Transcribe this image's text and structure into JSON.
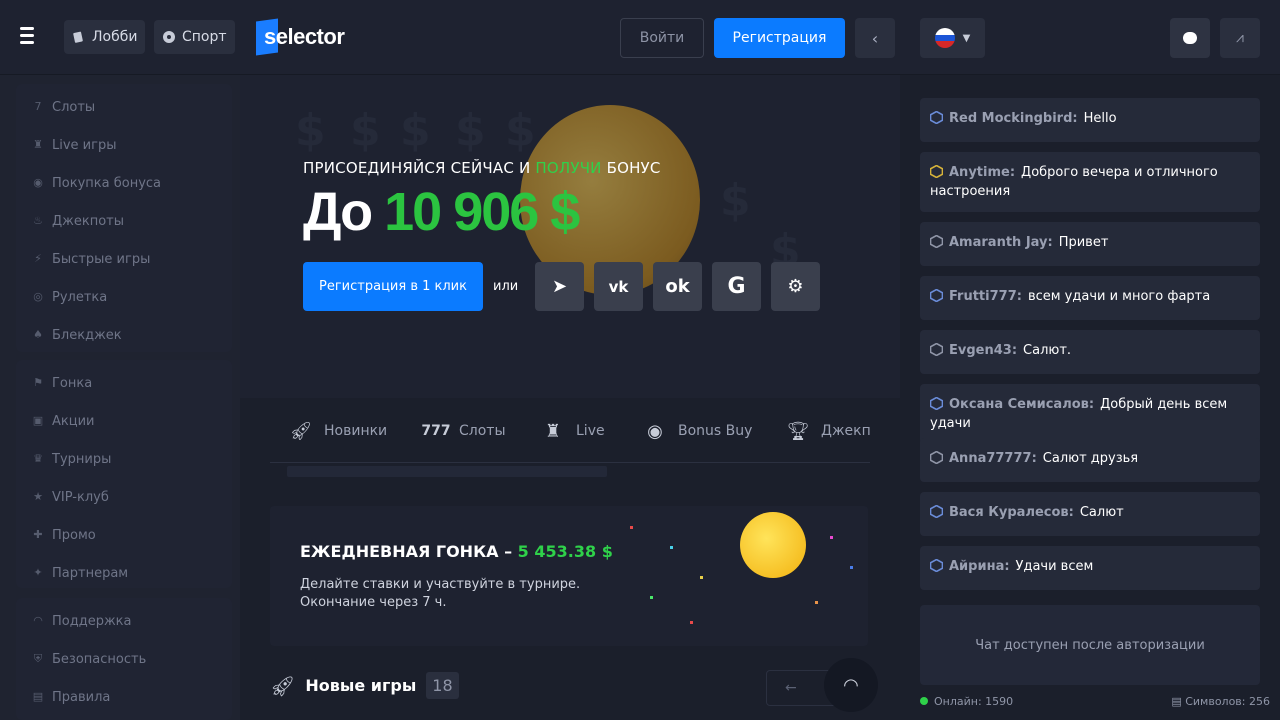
{
  "header": {
    "lobby_label": "Лобби",
    "sport_label": "Спорт",
    "logo_text": "selector",
    "login_label": "Войти",
    "register_label": "Регистрация"
  },
  "sidebar": {
    "group1": [
      {
        "label": "Слоты",
        "icon": "slots-icon"
      },
      {
        "label": "Live игры",
        "icon": "live-icon"
      },
      {
        "label": "Покупка бонуса",
        "icon": "bonus-buy-icon"
      },
      {
        "label": "Джекпоты",
        "icon": "jackpot-icon"
      },
      {
        "label": "Быстрые игры",
        "icon": "fast-games-icon"
      },
      {
        "label": "Рулетка",
        "icon": "roulette-icon"
      },
      {
        "label": "Блекджек",
        "icon": "blackjack-icon"
      }
    ],
    "group2": [
      {
        "label": "Гонка",
        "icon": "race-icon"
      },
      {
        "label": "Акции",
        "icon": "promotions-icon"
      },
      {
        "label": "Турниры",
        "icon": "tournaments-icon"
      },
      {
        "label": "VIP-клуб",
        "icon": "vip-icon"
      },
      {
        "label": "Промо",
        "icon": "promo-icon"
      },
      {
        "label": "Партнерам",
        "icon": "partners-icon"
      }
    ],
    "group3": [
      {
        "label": "Поддержка",
        "icon": "support-icon"
      },
      {
        "label": "Безопасность",
        "icon": "security-icon"
      },
      {
        "label": "Правила",
        "icon": "rules-icon"
      }
    ]
  },
  "hero": {
    "subtitle_a": "ПРИСОЕДИНЯЙСЯ СЕЙЧАС И ",
    "subtitle_b": "ПОЛУЧИ",
    "subtitle_c": " БОНУС",
    "big_a": "До ",
    "big_b": "10 906 $",
    "cta_label": "Регистрация в 1 клик",
    "or_label": "или",
    "social": [
      "telegram-icon",
      "vk-icon",
      "odnoklassniki-icon",
      "google-icon",
      "steam-icon"
    ]
  },
  "tabs": [
    {
      "label": "Новинки",
      "icon": "rocket-icon"
    },
    {
      "label": "Слоты",
      "icon": "slots-icon"
    },
    {
      "label": "Live",
      "icon": "live-icon"
    },
    {
      "label": "Bonus Buy",
      "icon": "bonus-buy-icon"
    },
    {
      "label": "Джекпо",
      "icon": "trophy-icon"
    }
  ],
  "race": {
    "title_a": "ЕЖЕДНЕВНАЯ ГОНКА – ",
    "title_b": "5 453.38 $",
    "desc1": "Делайте ставки и участвуйте в турнире.",
    "desc2": "Окончание через 7 ч."
  },
  "new_games": {
    "label": "Новые игры",
    "count": "18"
  },
  "chat": {
    "messages": [
      {
        "name": "Red Mockingbird:",
        "text": "Hello",
        "badge": "#6a8cd8"
      },
      {
        "name": "Anytime:",
        "text": "Доброго вечера и отличного настроения",
        "badge": "#d6b33a"
      },
      {
        "name": "Amaranth Jay:",
        "text": "Привет",
        "badge": "#8f95a7"
      },
      {
        "name": "Frutti777:",
        "text": "всем удачи и много фарта",
        "badge": "#6a8cd8"
      },
      {
        "name": "Evgen43:",
        "text": "Салют.",
        "badge": "#8f95a7"
      },
      {
        "name": "Оксана Семисалов:",
        "text": "Добрый день всем удачи",
        "badge": "#6a8cd8"
      },
      {
        "name": "Anna77777:",
        "text": "Салют друзья",
        "badge": "#8f95a7"
      },
      {
        "name": "Вася Куралесов:",
        "text": "Салют",
        "badge": "#6a8cd8"
      },
      {
        "name": "Айрина:",
        "text": "Удачи всем",
        "badge": "#6a8cd8"
      }
    ],
    "locked_text": "Чат доступен после авторизации",
    "online_label": "Онлайн: 1590",
    "symbols_label": "Символов: 256"
  },
  "colors": {
    "accent": "#0b7bff",
    "green": "#2fd14a",
    "bg": "#1b1f2b"
  }
}
